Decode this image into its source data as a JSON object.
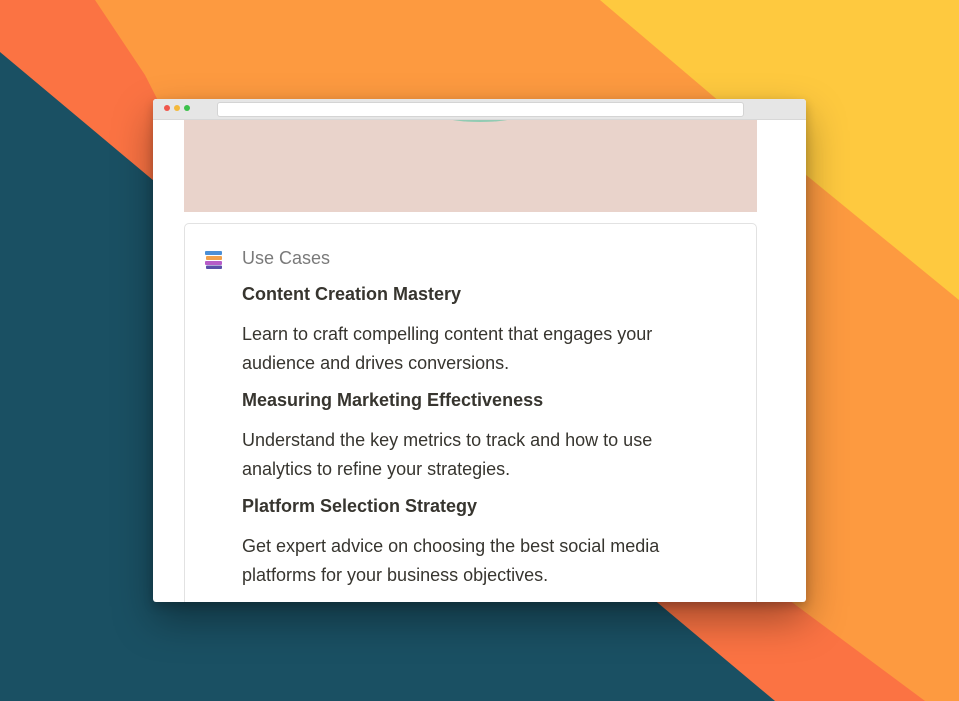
{
  "card": {
    "title": "Use Cases",
    "icon": "books-icon",
    "items": [
      {
        "title": "Content Creation Mastery",
        "description": "Learn to craft compelling content that engages your audience and drives conversions."
      },
      {
        "title": "Measuring Marketing Effectiveness",
        "description": "Understand the key metrics to track and how to use analytics to refine your strategies."
      },
      {
        "title": "Platform Selection Strategy",
        "description": "Get expert advice on choosing the best social media platforms for your business objectives."
      }
    ]
  },
  "colors": {
    "background_teal": "#1a5063",
    "background_orange_red": "#fb7343",
    "background_orange": "#fd9a40",
    "background_yellow": "#fec93f",
    "banner": "#e9d3cb"
  }
}
